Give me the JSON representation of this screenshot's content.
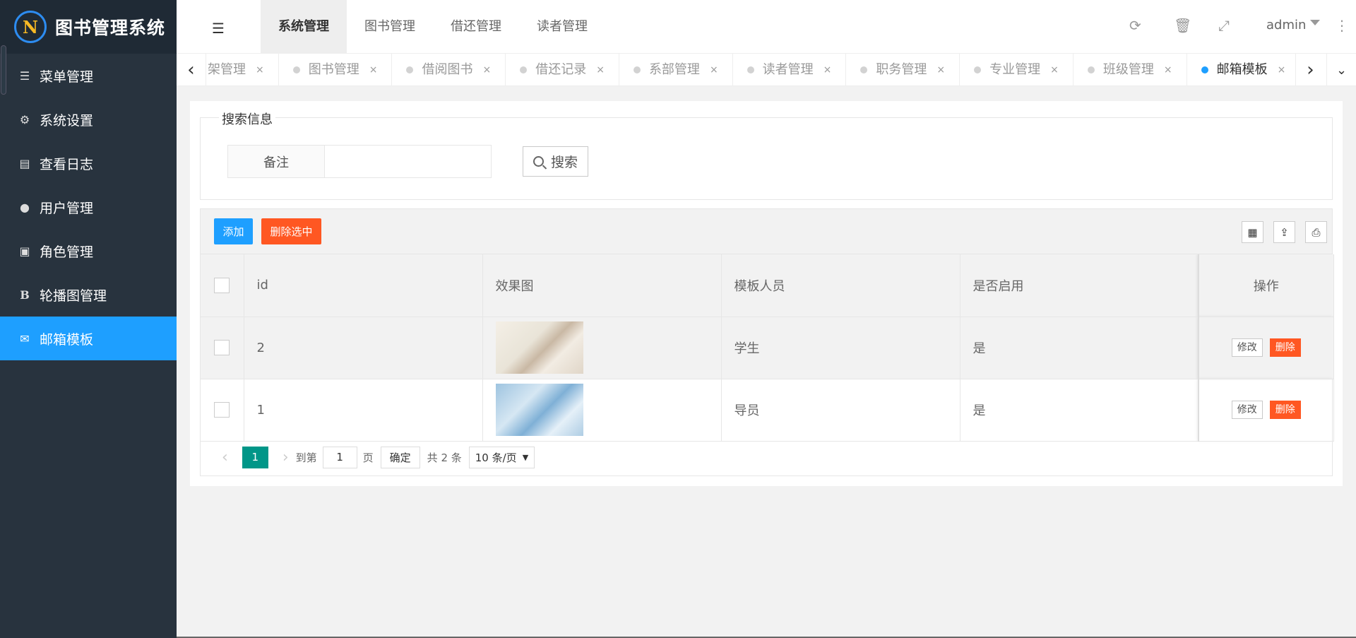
{
  "app": {
    "logo_glyph": "N",
    "title": "图书管理系统"
  },
  "sidebar": {
    "items": [
      {
        "icon": "menu-icon",
        "label": "菜单管理"
      },
      {
        "icon": "gear-icon",
        "label": "系统设置"
      },
      {
        "icon": "document-icon",
        "label": "查看日志"
      },
      {
        "icon": "user-icon",
        "label": "用户管理"
      },
      {
        "icon": "address-book-icon",
        "label": "角色管理"
      },
      {
        "icon": "bold-icon",
        "label": "轮播图管理"
      },
      {
        "icon": "envelope-icon",
        "label": "邮箱模板",
        "active": true
      }
    ]
  },
  "header": {
    "nav": [
      "系统管理",
      "图书管理",
      "借还管理",
      "读者管理"
    ],
    "active_nav": "系统管理",
    "user": "admin"
  },
  "tabs": {
    "items": [
      {
        "label": "架管理"
      },
      {
        "label": "图书管理"
      },
      {
        "label": "借阅图书"
      },
      {
        "label": "借还记录"
      },
      {
        "label": "系部管理"
      },
      {
        "label": "读者管理"
      },
      {
        "label": "职务管理"
      },
      {
        "label": "专业管理"
      },
      {
        "label": "班级管理"
      },
      {
        "label": "邮箱模板",
        "active": true
      }
    ],
    "close_glyph": "×"
  },
  "search": {
    "legend": "搜索信息",
    "field_label": "备注",
    "field_value": "",
    "button_label": "搜索"
  },
  "toolbar": {
    "add_label": "添加",
    "delete_selected_label": "删除选中"
  },
  "table": {
    "columns": [
      "id",
      "效果图",
      "模板人员",
      "是否启用",
      "操作"
    ],
    "rows": [
      {
        "id": "2",
        "image": "template-image-2",
        "person": "学生",
        "enabled": "是",
        "edit": "修改",
        "delete": "删除"
      },
      {
        "id": "1",
        "image": "template-image-1",
        "person": "导员",
        "enabled": "是",
        "edit": "修改",
        "delete": "删除"
      }
    ]
  },
  "pager": {
    "current_page": "1",
    "goto_label": "到第",
    "goto_value": "1",
    "page_unit": "页",
    "confirm_label": "确定",
    "total_label": "共 2 条",
    "page_size": "10 条/页"
  },
  "colors": {
    "accent": "#1e9fff",
    "danger": "#ff5722",
    "pager_current": "#009688",
    "sidebar_bg": "#28333e"
  }
}
